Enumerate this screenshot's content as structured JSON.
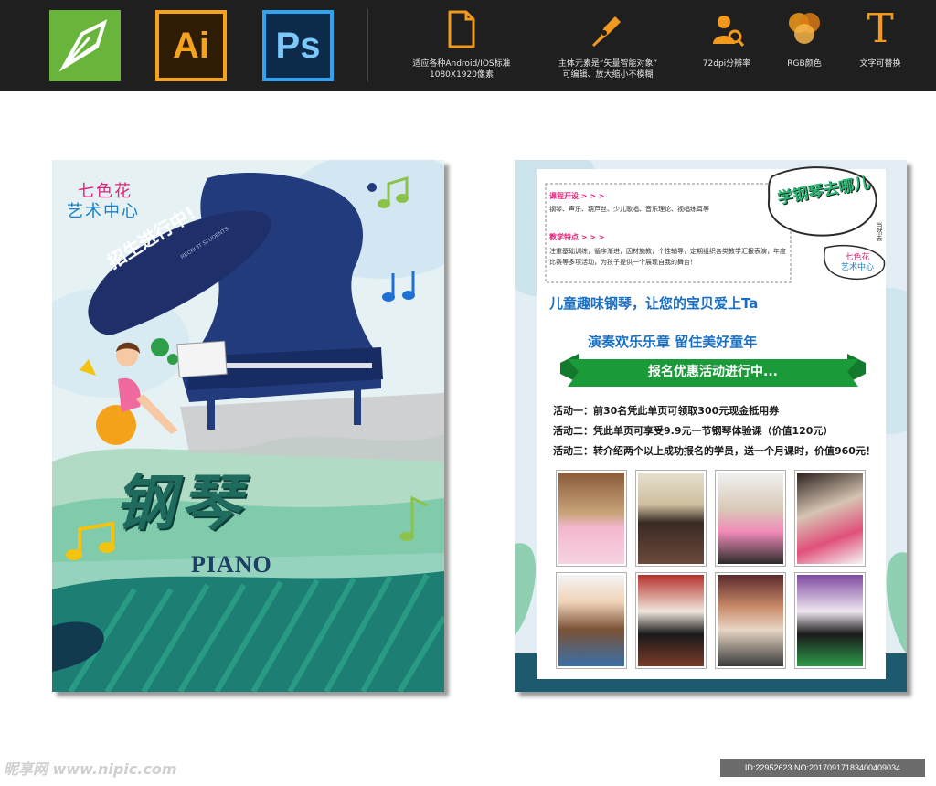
{
  "toolbar": {
    "apps": [
      {
        "name": "CorelDRAW",
        "label": ""
      },
      {
        "name": "Illustrator",
        "label": "Ai"
      },
      {
        "name": "Photoshop",
        "label": "Ps"
      }
    ],
    "features": [
      {
        "icon": "document-icon",
        "line1": "适应各种Android/IOS标准",
        "line2": "1080X1920像素"
      },
      {
        "icon": "pen-tool-icon",
        "line1": "主体元素是“矢量智能对象”",
        "line2": "可编辑、放大缩小不模糊"
      },
      {
        "icon": "resolution-icon",
        "line1": "72dpi分辨率",
        "line2": ""
      },
      {
        "icon": "rgb-color-icon",
        "line1": "RGB颜色",
        "line2": ""
      },
      {
        "icon": "text-icon",
        "line1": "文字可替换",
        "line2": ""
      }
    ],
    "text_icon_glyph": "T"
  },
  "left_poster": {
    "brand_line1": "七色花",
    "brand_line2": "艺术中心",
    "banner_text": "招生进行中!",
    "banner_sub": "RECRUIT STUDENTS",
    "title_cn": "钢琴",
    "title_en": "PIANO"
  },
  "right_poster": {
    "course_title": "课程开设 > > >",
    "course_text": "钢琴、声乐、葫芦丝、少儿歌唱、音乐理论、视唱练耳等",
    "feature_title": "教学特点 > > >",
    "feature_text": "注重基础训练，循序渐进，因材施教，个性辅导，定期组织各类教学汇报表演，年度比赛等多项活动，为孩子提供一个展现自我的舞台！",
    "badge_text": "学钢琴去哪儿",
    "badge_side": "当然去",
    "brand_line1": "七色花",
    "brand_line2": "艺术中心",
    "slogan1": "儿童趣味钢琴，让您的宝贝爱上Ta",
    "slogan2": "演奏欢乐乐章 留住美好童年",
    "ribbon_text": "报名优惠活动进行中...",
    "activities": [
      "活动一：前30名凭此单页可领取300元现金抵用券",
      "活动二：凭此单页可享受9.9元一节钢琴体验课（价值120元）",
      "活动三：转介绍两个以上成功报名的学员，送一个月课时，价值960元！"
    ]
  },
  "watermark": {
    "site": "昵享网 www.nipic.com",
    "id_text": "ID:22952623 NO:20170917183400409034"
  },
  "colors": {
    "topbar": "#1f1f1f",
    "navy": "#1e2f6b",
    "teal": "#1e8a6e",
    "ribbon_green": "#1b9a3a",
    "slogan_blue": "#1a6fc4",
    "pink": "#e0247a"
  }
}
